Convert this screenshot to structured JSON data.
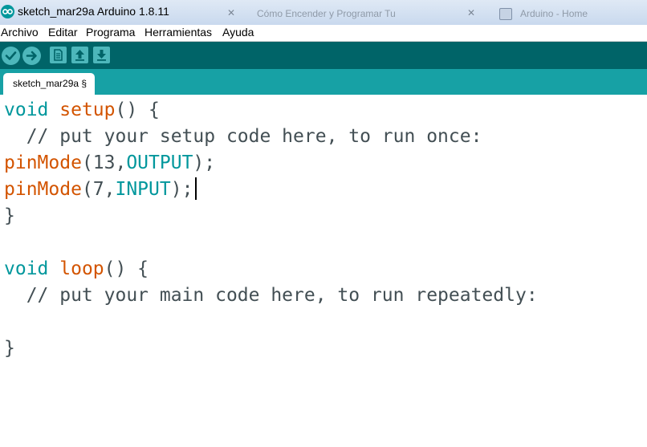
{
  "window": {
    "title": "sketch_mar29a Arduino 1.8.11",
    "background_tabs": [
      {
        "label": "Cómo Encender y Programar Tu"
      },
      {
        "label": "Arduino - Home"
      }
    ]
  },
  "menu": {
    "items": [
      "Archivo",
      "Editar",
      "Programa",
      "Herramientas",
      "Ayuda"
    ]
  },
  "toolbar": {
    "buttons": [
      "verify-icon",
      "upload-icon",
      "new-icon",
      "open-icon",
      "save-icon"
    ]
  },
  "tabs": {
    "active": "sketch_mar29a §"
  },
  "editor": {
    "line1": {
      "type": "void",
      "func": "setup",
      "rest": "() {"
    },
    "line2": {
      "comment": "  // put your setup code here, to run once:"
    },
    "line3": {
      "func": "pinMode",
      "open": "(13,",
      "const": "OUTPUT",
      "close": ");"
    },
    "line4": {
      "func": "pinMode",
      "open": "(7,",
      "const": "INPUT",
      "close": ");"
    },
    "line5": {
      "text": "}"
    },
    "line7": {
      "type": "void",
      "func": "loop",
      "rest": "() {"
    },
    "line8": {
      "comment": "  // put your main code here, to run repeatedly:"
    },
    "line10": {
      "text": "}"
    }
  },
  "colors": {
    "toolbar": "#006468",
    "tab_row": "#17a1a5",
    "keyword": "#00979c",
    "function": "#d35400"
  }
}
